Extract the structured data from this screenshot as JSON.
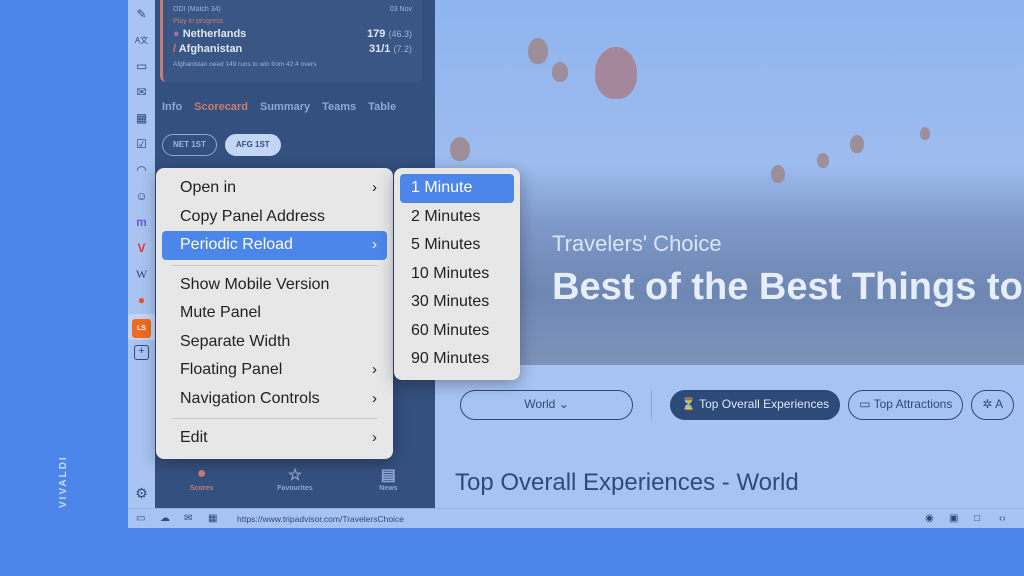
{
  "brand": "VIVALDI",
  "sidebar_icons": [
    "notes-icon",
    "translate-icon",
    "window-icon",
    "mail-icon",
    "calendar-icon",
    "tasks-icon",
    "feed-icon",
    "contacts-icon",
    "mastodon-icon",
    "vivaldi-icon",
    "wikipedia-icon",
    "reddit-icon",
    "livescore-icon",
    "add-panel-icon"
  ],
  "panel": {
    "match": {
      "title": "ODI (Match 34)",
      "date": "03 Nov",
      "status": "Play in progress",
      "teams": [
        {
          "name": "Netherlands",
          "score": "179",
          "overs": "(46.3)"
        },
        {
          "name": "Afghanistan",
          "score": "31/1",
          "overs": "(7.2)"
        }
      ],
      "note": "Afghanistan need 149 runs to win from 42.4 overs"
    },
    "tabs": [
      "Info",
      "Scorecard",
      "Summary",
      "Teams",
      "Table"
    ],
    "active_tab": "Scorecard",
    "innings": [
      "NET 1ST",
      "AFG 1ST"
    ],
    "bottom_nav": [
      "Scores",
      "Favourites",
      "News"
    ]
  },
  "context_menu": {
    "items": [
      {
        "label": "Open in",
        "submenu": true
      },
      {
        "label": "Copy Panel Address",
        "submenu": false
      },
      {
        "label": "Periodic Reload",
        "submenu": true,
        "highlighted": true
      },
      {
        "sep": true
      },
      {
        "label": "Show Mobile Version",
        "submenu": false
      },
      {
        "label": "Mute Panel",
        "submenu": false
      },
      {
        "label": "Separate Width",
        "submenu": false
      },
      {
        "label": "Floating Panel",
        "submenu": true
      },
      {
        "label": "Navigation Controls",
        "submenu": true
      },
      {
        "sep": true
      },
      {
        "label": "Edit",
        "submenu": true
      }
    ]
  },
  "submenu": {
    "items": [
      "1 Minute",
      "2 Minutes",
      "5 Minutes",
      "10 Minutes",
      "30 Minutes",
      "60 Minutes",
      "90 Minutes"
    ],
    "highlighted": "1 Minute"
  },
  "web": {
    "hero_subtitle": "Travelers' Choice",
    "hero_title": "Best of the Best Things to",
    "region": "World",
    "filters": [
      "Top Overall Experiences",
      "Top Attractions",
      "A"
    ],
    "active_filter": "Top Overall Experiences",
    "heading": "Top Overall Experiences - World"
  },
  "statusbar": {
    "url": "https://www.tripadvisor.com/TravelersChoice"
  },
  "colors": {
    "accent": "#4d86ea",
    "panel": "#34507f",
    "highlight_text": "#c97c72"
  }
}
